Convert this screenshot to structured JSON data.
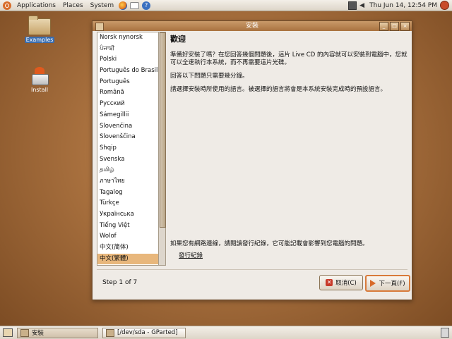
{
  "top_panel": {
    "menus": [
      "Applications",
      "Places",
      "System"
    ],
    "clock": "Thu Jun 14, 12:54 PM"
  },
  "desktop": {
    "icons": [
      {
        "label": "Examples"
      },
      {
        "label": "Install"
      }
    ]
  },
  "window": {
    "title": "安裝",
    "languages": [
      "Norsk nynorsk",
      "ਪੰਜਾਬੀ",
      "Polski",
      "Português do Brasil",
      "Português",
      "Română",
      "Русский",
      "Sámegillii",
      "Slovenčina",
      "Slovenščina",
      "Shqip",
      "Svenska",
      "தமிழ்",
      "ภาษาไทย",
      "Tagalog",
      "Türkçe",
      "Українська",
      "Tiếng Việt",
      "Wolof",
      "中文(简体)",
      "中文(繁體)"
    ],
    "selected_language": "中文(繁體)",
    "heading": "歡迎",
    "paragraphs": [
      "準備好安裝了嗎？在您回答幾個問題後，這片 Live CD 的內容就可以安裝到電腦中，您就可以全速執行本系統，而不再需要這片光碟。",
      "回答以下問題只需要幾分鐘。",
      "請選擇安裝時所使用的語言。被選擇的語言將會是本系統安裝完成時的預設語言。"
    ],
    "network_note": "如果您有網路連線，請閱讀發行紀錄，它可能記載會影響到您電腦的問題。",
    "release_notes_link": "發行紀錄",
    "step": "Step 1 of 7",
    "cancel_label": "取消(C)",
    "next_label": "下一頁(F)"
  },
  "bottom_panel": {
    "tasks": [
      "安裝",
      "[/dev/sda - GParted]"
    ]
  }
}
